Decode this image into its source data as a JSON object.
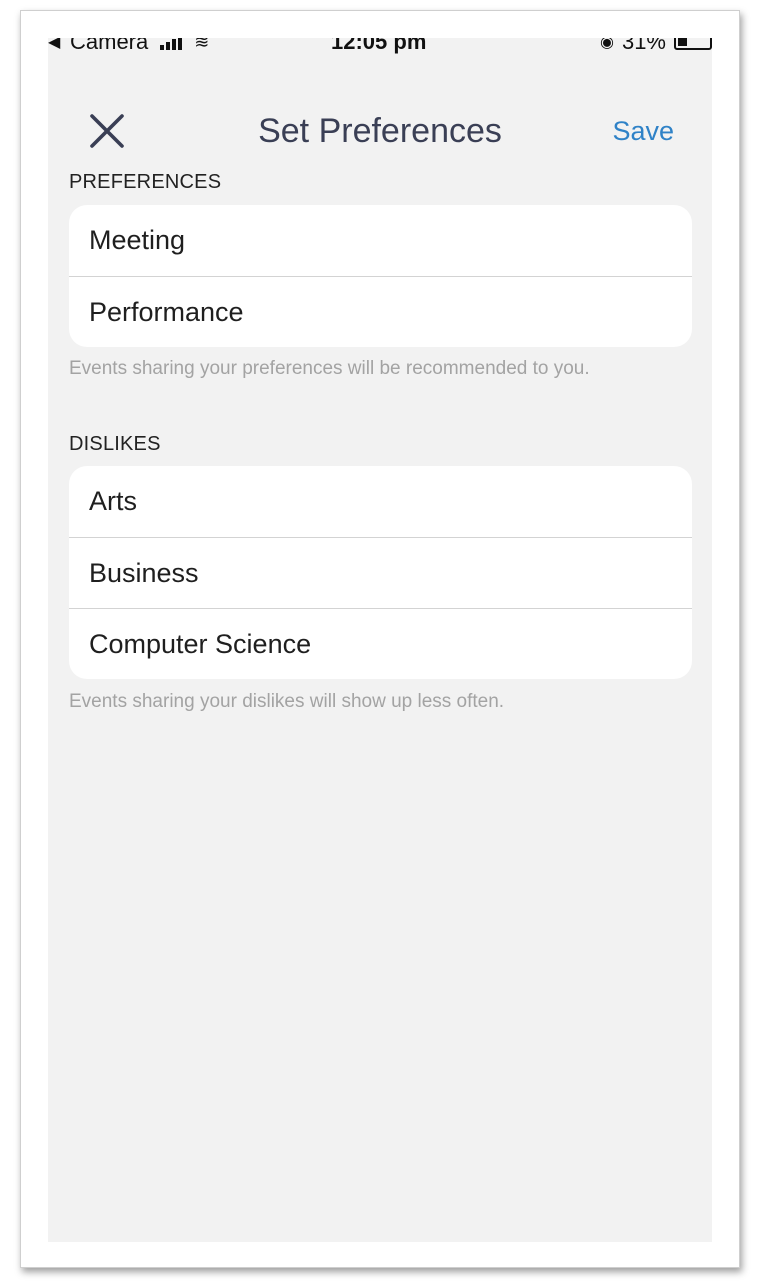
{
  "status_bar": {
    "back_app": "Camera",
    "time": "12:05 pm",
    "battery": "31%",
    "battery_level": 0.31
  },
  "nav": {
    "title": "Set Preferences",
    "save_label": "Save",
    "close_icon": "close-icon"
  },
  "preferences": {
    "header": "PREFERENCES",
    "items": [
      {
        "label": "Meeting"
      },
      {
        "label": "Performance"
      }
    ],
    "footer": "Events sharing your preferences will be recommended to you."
  },
  "dislikes": {
    "header": "DISLIKES",
    "items": [
      {
        "label": "Arts"
      },
      {
        "label": "Business"
      },
      {
        "label": "Computer Science"
      }
    ],
    "footer": "Events sharing your dislikes will show up less often."
  },
  "colors": {
    "screen_background": "#f2f2f2",
    "accent": "#2f82c7",
    "title": "#3a3f55",
    "footer_text": "#a3a3a3"
  }
}
